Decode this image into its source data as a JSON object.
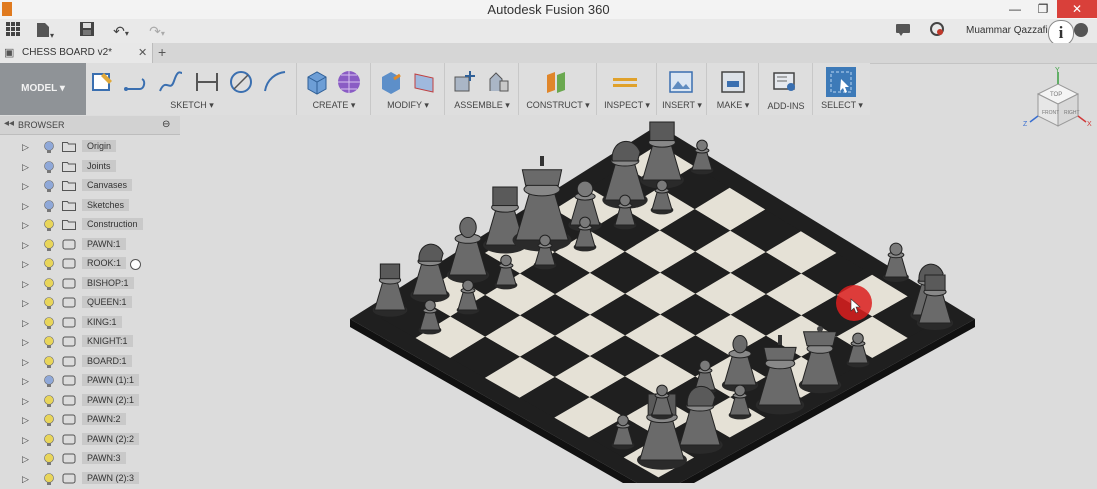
{
  "window": {
    "title": "Autodesk Fusion 360",
    "controls": [
      "minimize-icon",
      "restore-icon",
      "close-icon"
    ]
  },
  "quick_access": {
    "icons": [
      "grid-icon",
      "file-icon",
      "save-icon",
      "undo-icon",
      "redo-icon"
    ],
    "user": "Muammar Qazzafi ▾",
    "right_icons": [
      "chat-icon",
      "clock-icon",
      "info-icon",
      "help-icon"
    ]
  },
  "tab": {
    "title": "CHESS BOARD v2*",
    "close": "✕",
    "new": "+"
  },
  "toolbar": {
    "workspace": "MODEL ▾",
    "groups": [
      {
        "label": "SKETCH ▾"
      },
      {
        "label": "CREATE ▾"
      },
      {
        "label": "MODIFY ▾"
      },
      {
        "label": "ASSEMBLE ▾"
      },
      {
        "label": "CONSTRUCT ▾"
      },
      {
        "label": "INSPECT ▾"
      },
      {
        "label": "INSERT ▾"
      },
      {
        "label": "MAKE ▾"
      },
      {
        "label": "ADD-INS"
      },
      {
        "label": "SELECT ▾"
      }
    ]
  },
  "browser": {
    "title": "BROWSER",
    "items": [
      {
        "label": "Origin",
        "bulb": "#8fa8d8",
        "type": "folder"
      },
      {
        "label": "Joints",
        "bulb": "#8fa8d8",
        "type": "folder"
      },
      {
        "label": "Canvases",
        "bulb": "#8fa8d8",
        "type": "folder"
      },
      {
        "label": "Sketches",
        "bulb": "#8fa8d8",
        "type": "folder"
      },
      {
        "label": "Construction",
        "bulb": "#e8d55a",
        "type": "folder"
      },
      {
        "label": "PAWN:1",
        "bulb": "#e8d55a",
        "type": "component"
      },
      {
        "label": "ROOK:1",
        "bulb": "#e8d55a",
        "type": "component"
      },
      {
        "label": "BISHOP:1",
        "bulb": "#e8d55a",
        "type": "component"
      },
      {
        "label": "QUEEN:1",
        "bulb": "#e8d55a",
        "type": "component"
      },
      {
        "label": "KING:1",
        "bulb": "#e8d55a",
        "type": "component"
      },
      {
        "label": "KNIGHT:1",
        "bulb": "#e8d55a",
        "type": "component"
      },
      {
        "label": "BOARD:1",
        "bulb": "#e8d55a",
        "type": "component"
      },
      {
        "label": "PAWN (1):1",
        "bulb": "#8fa8d8",
        "type": "component"
      },
      {
        "label": "PAWN (2):1",
        "bulb": "#e8d55a",
        "type": "component"
      },
      {
        "label": "PAWN:2",
        "bulb": "#e8d55a",
        "type": "component"
      },
      {
        "label": "PAWN (2):2",
        "bulb": "#e8d55a",
        "type": "component"
      },
      {
        "label": "PAWN:3",
        "bulb": "#e8d55a",
        "type": "component"
      },
      {
        "label": "PAWN (2):3",
        "bulb": "#e8d55a",
        "type": "component"
      }
    ]
  },
  "viewcube": {
    "faces": [
      "TOP",
      "FRONT",
      "RIGHT"
    ],
    "axes": [
      "Y",
      "Z",
      "X"
    ]
  },
  "colors": {
    "dark_square": "#1f1f1f",
    "light_square": "#e5e1d6",
    "accent_select": "#3d7ab8",
    "cursor_highlight": "#dc1e1e"
  }
}
